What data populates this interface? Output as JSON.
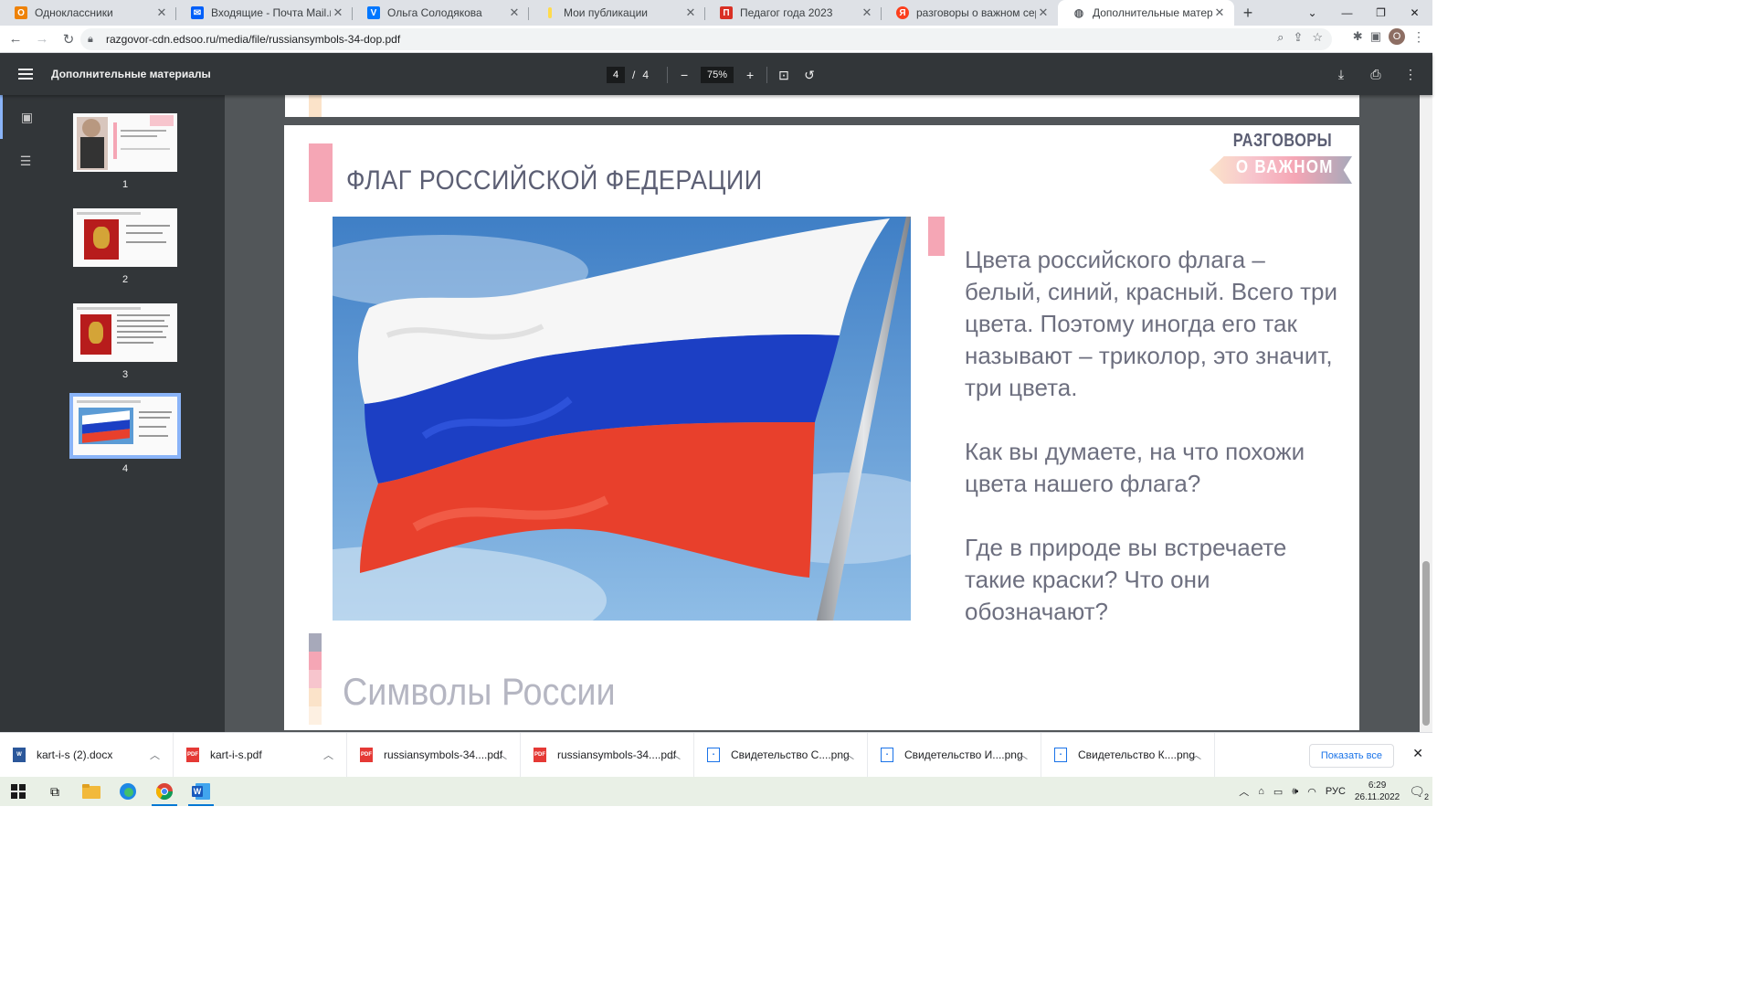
{
  "browser": {
    "tabs": [
      {
        "title": "Одноклассники",
        "favicon": "ok",
        "color": "#ee8208",
        "active": false
      },
      {
        "title": "Входящие - Почта Mail.ru",
        "favicon": "mail",
        "color": "#005ff9",
        "active": false
      },
      {
        "title": "Ольга Солодякова",
        "favicon": "vk",
        "color": "#0077ff",
        "active": false
      },
      {
        "title": "Мои публикации",
        "favicon": "zen",
        "color": "#ffdb4d",
        "active": false
      },
      {
        "title": "Педагог года 2023",
        "favicon": "pedagog",
        "color": "#d93025",
        "active": false
      },
      {
        "title": "разговоры о важном сервис д",
        "favicon": "yandex",
        "color": "#fc3f1d",
        "active": false
      },
      {
        "title": "Дополнительные материалы",
        "favicon": "globe",
        "color": "#5f6368",
        "active": true
      }
    ],
    "url": "razgovor-cdn.edsoo.ru/media/file/russiansymbols-34-dop.pdf",
    "profile_initial": "O"
  },
  "pdf": {
    "title": "Дополнительные материалы",
    "current_page": "4",
    "page_sep": "/",
    "total_pages": "4",
    "zoom": "75%",
    "thumbnails": [
      {
        "num": "1"
      },
      {
        "num": "2"
      },
      {
        "num": "3"
      },
      {
        "num": "4"
      }
    ]
  },
  "slide": {
    "title": "ФЛАГ РОССИЙСКОЙ ФЕДЕРАЦИИ",
    "logo_line1": "РАЗГОВОРЫ",
    "logo_line2": "О ВАЖНОМ",
    "paragraphs": [
      "Цвета российского флага – белый, синий, красный. Всего три цвета. Поэтому иногда его так называют – триколор, это значит, три цвета.",
      "Как вы думаете, на что похожи цвета нашего флага?",
      "Где в природе вы встречаете такие краски? Что они обозначают?"
    ],
    "footer": "Символы России",
    "colors": {
      "accent_pink": "#f5a6b5",
      "flag_white": "#ffffff",
      "flag_blue": "#1c3fc4",
      "flag_red": "#e8402c"
    }
  },
  "downloads": {
    "items": [
      {
        "name": "kart-i-s (2).docx",
        "type": "docx"
      },
      {
        "name": "kart-i-s.pdf",
        "type": "pdf"
      },
      {
        "name": "russiansymbols-34....pdf",
        "type": "pdf"
      },
      {
        "name": "russiansymbols-34....pdf",
        "type": "pdf"
      },
      {
        "name": "Свидетельство С....png",
        "type": "png"
      },
      {
        "name": "Свидетельство И....png",
        "type": "png"
      },
      {
        "name": "Свидетельство К....png",
        "type": "png"
      }
    ],
    "show_all": "Показать все"
  },
  "taskbar": {
    "lang": "РУС",
    "time": "6:29",
    "date": "26.11.2022",
    "notifications": "2"
  }
}
